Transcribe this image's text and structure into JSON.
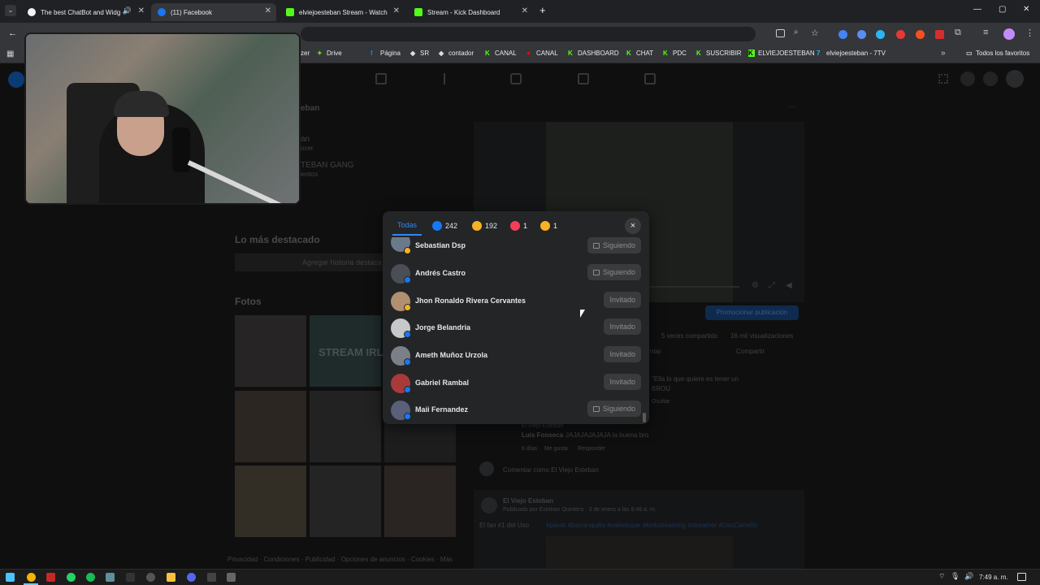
{
  "browser": {
    "tabs": [
      {
        "title": "The best ChatBot and Widg",
        "color": "#f1f3f4"
      },
      {
        "title": "(11) Facebook",
        "color": "#1877f2"
      },
      {
        "title": "elviejoesteban Stream - Watch",
        "color": "#53fc18"
      },
      {
        "title": "Stream - Kick Dashboard",
        "color": "#53fc18"
      }
    ],
    "new_tab": "+",
    "bookmarks": [
      "zer",
      "Drive",
      "Página",
      "SR",
      "contador",
      "CANAL",
      "CANAL",
      "DASHBOARD",
      "CHAT",
      "PDC",
      "SUSCRIBIR",
      "ELVIEJOESTEBAN",
      "elviejoesteban - 7TV"
    ],
    "all_favorites": "Todos los favoritos"
  },
  "background_page": {
    "profile_name_partial": "eban",
    "profile_sub1": "an",
    "profile_sub1_meta": "ocer",
    "profile_sub2": "TEBAN GANG",
    "profile_sub2_meta": "ientos",
    "highlights_title": "Lo más destacado",
    "add_story": "Agregar historia destaca",
    "photos_title": "Fotos",
    "stream_photo_text": "STREAM IRL",
    "promote_button": "Promocionar publicación",
    "stats_shared": "5 veces compartido",
    "stats_views": "16 mil visualizaciones",
    "comment_btn_partial": "ntar",
    "share_btn": "Compartir",
    "comment_quote": "\"Ella lo que quiere es tener un",
    "comment_quote2": "BROU",
    "hide_text": "Ocultar",
    "reply_author": "El Viejo Esteban",
    "reply_text_author": "Luis Fonseca",
    "reply_text": "JAJAJAJAJAJA la buena bro",
    "reply_meta1": "6 días",
    "reply_meta2": "Me gusta",
    "reply_meta3": "Responder",
    "comment_as": "Comentar como El Viejo Esteban",
    "post_author": "El Viejo Esteban",
    "post_meta": "Publicado por Esteban Quintero · 3 de enero a las 8:46 a. m.",
    "post_text": "El fan #1 del Uso",
    "post_tags": "#parati #barranquilla #valledupar #kickstreaming #streamer #UsoCarreño",
    "footer": "Privacidad · Condiciones · Publicidad · Opciones de anuncios · Cookies · Más"
  },
  "reactions_modal": {
    "tabs": [
      {
        "label": "Todas",
        "emoji": "",
        "color": "#2d88ff"
      },
      {
        "label": "242",
        "emoji": "like",
        "color": "#1877f2"
      },
      {
        "label": "192",
        "emoji": "haha",
        "color": "#f7b125"
      },
      {
        "label": "1",
        "emoji": "love",
        "color": "#f33e58"
      },
      {
        "label": "1",
        "emoji": "wow",
        "color": "#f7b125"
      }
    ],
    "close_icon": "×",
    "people": [
      {
        "name": "Sebastian Dsp",
        "button": "Siguiendo",
        "following": true,
        "reaction_color": "#f7b125",
        "avatar_color": "#6b7a8a"
      },
      {
        "name": "Andrés Castro",
        "button": "Siguiendo",
        "following": true,
        "reaction_color": "#1877f2",
        "avatar_color": "#4a4f55"
      },
      {
        "name": "Jhon Ronaldo Rivera Cervantes",
        "button": "Invitado",
        "following": false,
        "reaction_color": "#f7b125",
        "avatar_color": "#b09070"
      },
      {
        "name": "Jorge Belandria",
        "button": "Invitado",
        "following": false,
        "reaction_color": "#1877f2",
        "avatar_color": "#c8c8c8"
      },
      {
        "name": "Ameth Muñoz Urzola",
        "button": "Invitado",
        "following": false,
        "reaction_color": "#1877f2",
        "avatar_color": "#7a8088"
      },
      {
        "name": "Gabriel Rambal",
        "button": "Invitado",
        "following": false,
        "reaction_color": "#1877f2",
        "avatar_color": "#a83a3a"
      },
      {
        "name": "Maii Fernandez",
        "button": "Siguiendo",
        "following": true,
        "reaction_color": "#1877f2",
        "avatar_color": "#5a5f7a"
      }
    ]
  },
  "taskbar": {
    "time": "7:49 a. m."
  }
}
